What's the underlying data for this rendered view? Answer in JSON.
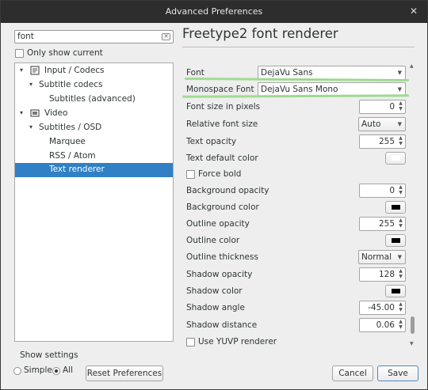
{
  "window": {
    "title": "Advanced Preferences",
    "close_glyph": "✕"
  },
  "search": {
    "value": "font",
    "clear_icon": "clear-icon"
  },
  "only_show_current": {
    "label": "Only show current",
    "checked": false
  },
  "tree": [
    {
      "label": "Input / Codecs",
      "arrow": "▾",
      "icon": "codec-icon"
    },
    {
      "label": "Subtitle codecs",
      "arrow": "▾"
    },
    {
      "label": "Subtitles (advanced)"
    },
    {
      "label": "Video",
      "arrow": "▾",
      "icon": "video-icon"
    },
    {
      "label": "Subtitles / OSD",
      "arrow": "▾"
    },
    {
      "label": "Marquee"
    },
    {
      "label": "RSS / Atom"
    },
    {
      "label": "Text renderer",
      "selected": true
    }
  ],
  "heading": "Freetype2 font renderer",
  "props": {
    "font": {
      "label": "Font",
      "value": "DejaVu Sans"
    },
    "monofont": {
      "label": "Monospace Font",
      "value": "DejaVu Sans Mono"
    },
    "font_size": {
      "label": "Font size in pixels",
      "value": "0"
    },
    "rel_size": {
      "label": "Relative font size",
      "value": "Auto"
    },
    "text_opacity": {
      "label": "Text opacity",
      "value": "255"
    },
    "text_color": {
      "label": "Text default color",
      "color": "#ffffff"
    },
    "force_bold": {
      "label": "Force bold",
      "checked": false
    },
    "bg_opacity": {
      "label": "Background opacity",
      "value": "0"
    },
    "bg_color": {
      "label": "Background color",
      "color": "#000000"
    },
    "outline_opacity": {
      "label": "Outline opacity",
      "value": "255"
    },
    "outline_color": {
      "label": "Outline color",
      "color": "#000000"
    },
    "outline_thickness": {
      "label": "Outline thickness",
      "value": "Normal"
    },
    "shadow_opacity": {
      "label": "Shadow opacity",
      "value": "128"
    },
    "shadow_color": {
      "label": "Shadow color",
      "color": "#000000"
    },
    "shadow_angle": {
      "label": "Shadow angle",
      "value": "-45.00"
    },
    "shadow_distance": {
      "label": "Shadow distance",
      "value": "0.06"
    },
    "yuvp": {
      "label": "Use YUVP renderer",
      "checked": false
    }
  },
  "show_settings": {
    "label": "Show settings",
    "simple": "Simple",
    "all": "All",
    "selected": "All"
  },
  "buttons": {
    "reset": "Reset Preferences",
    "cancel": "Cancel",
    "save": "Save"
  },
  "colors": {
    "selection": "#2f80c4",
    "highlight": "#98d98a",
    "titlebar": "#2d2d2d"
  }
}
